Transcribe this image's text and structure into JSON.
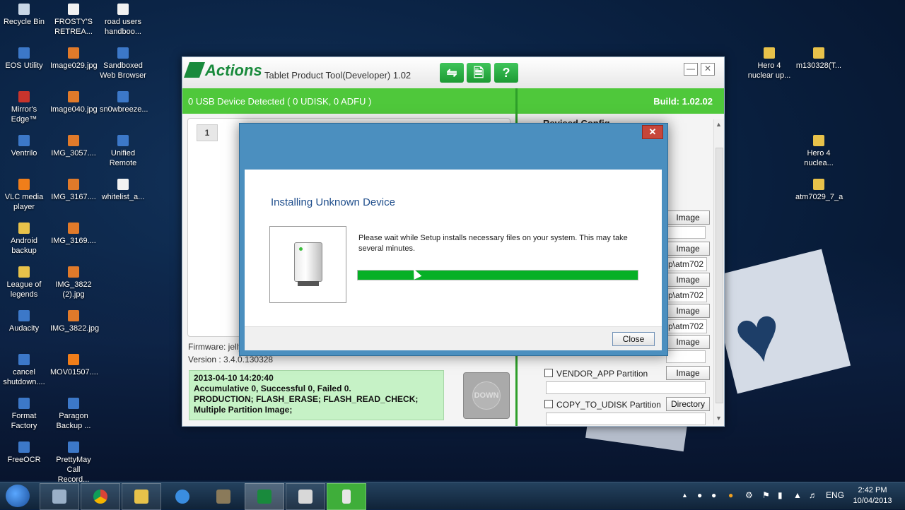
{
  "desktop": {
    "icons": [
      {
        "label": "Recycle Bin",
        "icon": "recycle-bin-icon"
      },
      {
        "label": "FROSTY'S\nRETREA...",
        "icon": "document-icon"
      },
      {
        "label": "road users\nhandboo...",
        "icon": "document-icon"
      },
      {
        "label": "EOS Utility",
        "icon": "app-icon"
      },
      {
        "label": "Image029.jpg",
        "icon": "image-icon"
      },
      {
        "label": "Sandboxed\nWeb Browser",
        "icon": "app-icon"
      },
      {
        "label": "Mirror's\nEdge™",
        "icon": "game-icon"
      },
      {
        "label": "Image040.jpg",
        "icon": "image-icon"
      },
      {
        "label": "sn0wbreeze...",
        "icon": "app-icon"
      },
      {
        "label": "Ventrilo",
        "icon": "app-icon"
      },
      {
        "label": "IMG_3057....",
        "icon": "image-icon"
      },
      {
        "label": "Unified\nRemote",
        "icon": "app-icon"
      },
      {
        "label": "VLC media\nplayer",
        "icon": "vlc-icon"
      },
      {
        "label": "IMG_3167....",
        "icon": "image-icon"
      },
      {
        "label": "whitelist_a...",
        "icon": "document-icon"
      },
      {
        "label": "Android\nbackup",
        "icon": "folder-icon"
      },
      {
        "label": "IMG_3169....",
        "icon": "image-icon"
      },
      {
        "label": "League of\nlegends",
        "icon": "folder-icon"
      },
      {
        "label": "IMG_3822\n(2).jpg",
        "icon": "image-icon"
      },
      {
        "label": "Audacity",
        "icon": "app-icon"
      },
      {
        "label": "IMG_3822.jpg",
        "icon": "image-icon"
      },
      {
        "label": "cancel\nshutdown....",
        "icon": "app-icon"
      },
      {
        "label": "MOV01507....",
        "icon": "video-icon"
      },
      {
        "label": "Format\nFactory",
        "icon": "app-icon"
      },
      {
        "label": "Paragon\nBackup ...",
        "icon": "app-icon"
      },
      {
        "label": "FreeOCR",
        "icon": "app-icon"
      },
      {
        "label": "PrettyMay\nCall Record...",
        "icon": "app-icon"
      },
      {
        "label": "Hero 4\nnuclear up...",
        "icon": "folder-icon"
      },
      {
        "label": "m130328(T...",
        "icon": "folder-icon"
      },
      {
        "label": "Hero 4\nnuclea...",
        "icon": "folder-icon"
      },
      {
        "label": "atm7029_7_a",
        "icon": "folder-icon"
      }
    ]
  },
  "tool": {
    "logo": "Actions",
    "title": "Tablet Product Tool(Developer) 1.02",
    "usb_status": "0 USB Device Detected ( 0 UDISK, 0 ADFU )",
    "build": "Build: 1.02.02",
    "tab_number": "1",
    "firmware": "Firmware: jelly",
    "version": "Version : 3.4.0.130328",
    "log_lines": [
      "2013-04-10 14:20:40",
      "Accumulative 0, Successful 0, Failed 0.",
      "PRODUCTION; FLASH_ERASE; FLASH_READ_CHECK;",
      "Multiple Partition Image;"
    ],
    "down_label": "DOWN",
    "right_header": "Revised Config",
    "image_label": "Image",
    "directory_label": "Directory",
    "path_text": "p\\atm702",
    "partitions": [
      "VENDOR_APP Partition",
      "COPY_TO_UDISK Partition"
    ]
  },
  "dialog": {
    "title": "Installing Unknown Device",
    "message": "Please wait while Setup installs necessary files on your system. This may take several minutes.",
    "progress_fraction": 1.0,
    "close_label": "Close"
  },
  "taskbar": {
    "language": "ENG",
    "time": "2:42 PM",
    "date": "10/04/2013"
  },
  "colors": {
    "accent_green": "#4fc83b",
    "progress_green": "#06b025",
    "dialog_frame": "#4b8fbf",
    "title_blue": "#1f4e8c"
  }
}
